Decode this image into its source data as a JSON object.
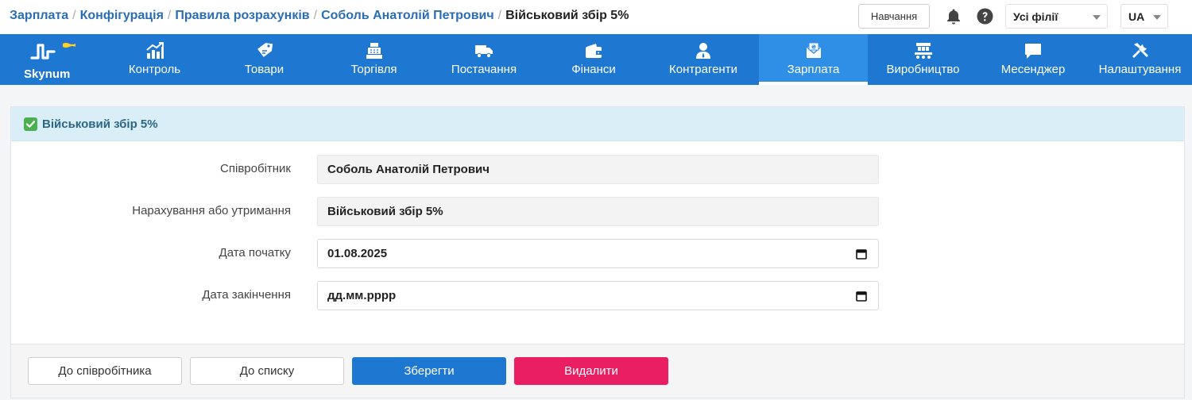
{
  "breadcrumb": {
    "items": [
      "Зарплата",
      "Конфігурація",
      "Правила розрахунків",
      "Соболь Анатолій Петрович"
    ],
    "current": "Військовий збір 5%",
    "separator": "/"
  },
  "header": {
    "help_label": "Навчання",
    "branch_select": "Усі філії",
    "lang_select": "UA"
  },
  "nav": {
    "logo_text": "Skynum",
    "items": [
      {
        "label": "Контроль",
        "icon": "chart-growth-icon"
      },
      {
        "label": "Товари",
        "icon": "price-tag-icon"
      },
      {
        "label": "Торгівля",
        "icon": "cash-register-icon"
      },
      {
        "label": "Постачання",
        "icon": "truck-icon"
      },
      {
        "label": "Фінанси",
        "icon": "wallet-icon"
      },
      {
        "label": "Контрагенти",
        "icon": "person-icon"
      },
      {
        "label": "Зарплата",
        "icon": "payroll-envelope-icon",
        "active": true
      },
      {
        "label": "Виробництво",
        "icon": "factory-conveyor-icon"
      },
      {
        "label": "Месенджер",
        "icon": "chat-bubble-icon"
      },
      {
        "label": "Налаштування",
        "icon": "tools-icon"
      }
    ]
  },
  "panel": {
    "title": "Військовий збір 5%",
    "fields": {
      "employee": {
        "label": "Співробітник",
        "value": "Соболь Анатолій Петрович"
      },
      "accrual": {
        "label": "Нарахування або утримання",
        "value": "Військовий збір 5%"
      },
      "start_date": {
        "label": "Дата початку",
        "value": "01.08.2025"
      },
      "end_date": {
        "label": "Дата закінчення",
        "value": "дд.мм.рррр"
      }
    },
    "buttons": {
      "to_employee": "До співробітника",
      "to_list": "До списку",
      "save": "Зберегти",
      "delete": "Видалити"
    }
  },
  "colors": {
    "nav_bg": "#1e78d2",
    "nav_active": "#2f8fe6",
    "link": "#2a6db5",
    "panel_head": "#d9eef7",
    "primary": "#1e78d2",
    "danger": "#e91e63",
    "check": "#4caf50"
  }
}
